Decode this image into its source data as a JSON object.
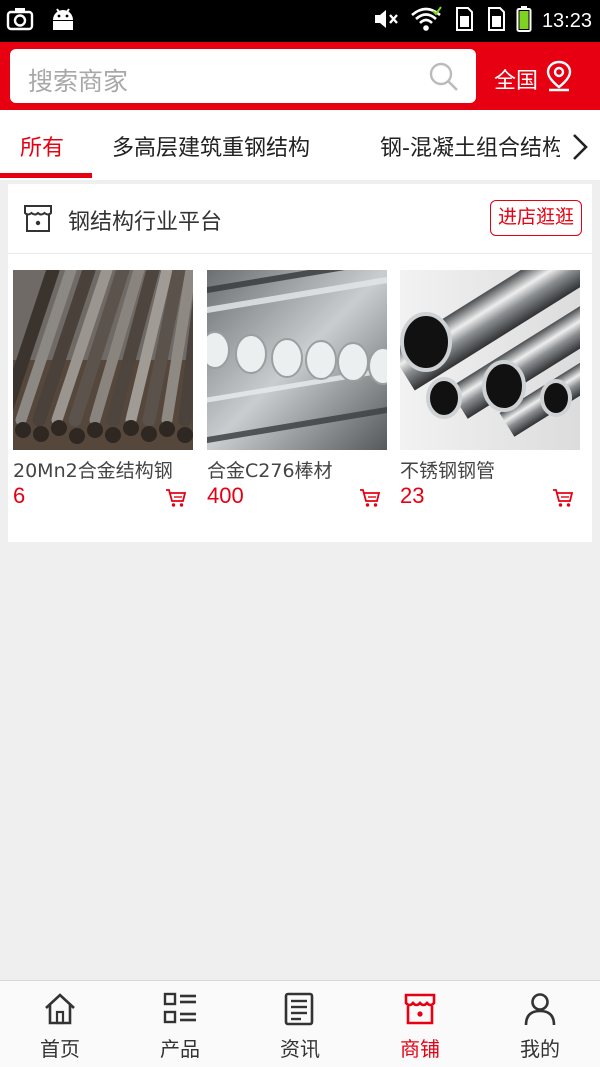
{
  "status_bar": {
    "time": "13:23"
  },
  "search": {
    "placeholder": "搜索商家"
  },
  "region": {
    "label": "全国"
  },
  "tabs": [
    {
      "label": "所有",
      "active": true
    },
    {
      "label": "多高层建筑重钢结构",
      "active": false
    },
    {
      "label": "钢-混凝土组合结构",
      "active": false
    }
  ],
  "shop": {
    "name": "钢结构行业平台",
    "enter_label": "进店逛逛",
    "products": [
      {
        "name": "20Mn2合金结构钢",
        "price": "6"
      },
      {
        "name": "合金C276棒材",
        "price": "400"
      },
      {
        "name": "不锈钢钢管",
        "price": "23"
      }
    ]
  },
  "bottom_nav": [
    {
      "label": "首页",
      "icon": "home-icon"
    },
    {
      "label": "产品",
      "icon": "product-list-icon"
    },
    {
      "label": "资讯",
      "icon": "news-icon"
    },
    {
      "label": "商铺",
      "icon": "shop-icon",
      "active": true
    },
    {
      "label": "我的",
      "icon": "user-icon"
    }
  ],
  "colors": {
    "accent": "#e60012",
    "background": "#efefef"
  }
}
